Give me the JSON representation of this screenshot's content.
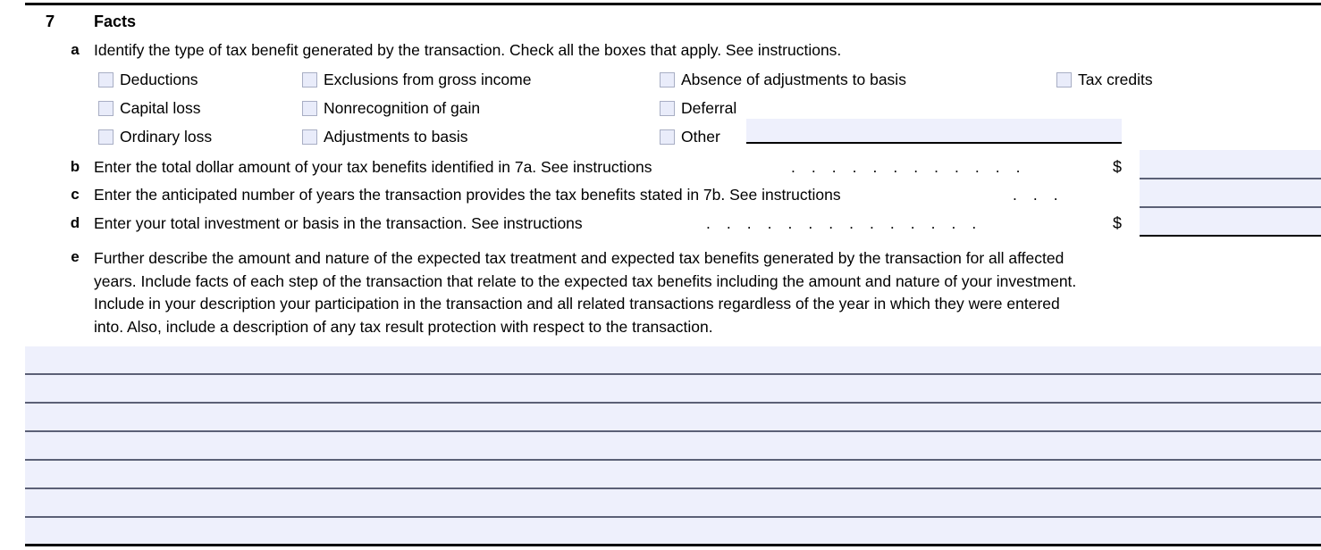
{
  "form": {
    "item_number": "7",
    "item_title": "Facts",
    "colors": {
      "field_fill": "#eef0fc",
      "checkbox_fill": "#e9ecfa",
      "checkbox_border": "#a8aec4",
      "rule_dark": "#000000",
      "rule_gray": "#5b6076"
    },
    "lines": {
      "a": {
        "letter": "a",
        "instruction": "Identify the type of tax benefit generated by the transaction. Check all the boxes that apply. See instructions.",
        "checkbox_columns": [
          [
            "Deductions",
            "Capital loss",
            "Ordinary loss"
          ],
          [
            "Exclusions from gross income",
            "Nonrecognition of gain",
            "Adjustments to basis"
          ],
          [
            "Absence of adjustments to basis",
            "Deferral",
            "Other"
          ],
          [
            "Tax credits"
          ]
        ],
        "other_value": ""
      },
      "b": {
        "letter": "b",
        "text": "Enter the total dollar amount of your tax benefits identified in 7a. See instructions",
        "leader_dots": 12,
        "currency_symbol": "$",
        "value": ""
      },
      "c": {
        "letter": "c",
        "text": "Enter the anticipated number of years the transaction provides the tax benefits stated in 7b. See instructions",
        "leader_dots": 3,
        "currency_symbol": "",
        "value": ""
      },
      "d": {
        "letter": "d",
        "text": "Enter your total investment or basis in the transaction. See instructions",
        "leader_dots": 14,
        "currency_symbol": "$",
        "value": ""
      },
      "e": {
        "letter": "e",
        "paragraph_lines": [
          "Further describe the amount and nature of the expected tax treatment and expected tax benefits generated by the transaction for all affected",
          "years. Include facts of each step of the transaction that relate to the expected tax benefits including the amount and nature of your investment.",
          "Include in your description your participation in the transaction and all related transactions regardless of the year in which they were entered",
          "into. Also, include a description of any tax result protection with respect to the transaction."
        ],
        "blank_line_count": 7,
        "blank_line_values": [
          "",
          "",
          "",
          "",
          "",
          "",
          ""
        ]
      }
    }
  }
}
